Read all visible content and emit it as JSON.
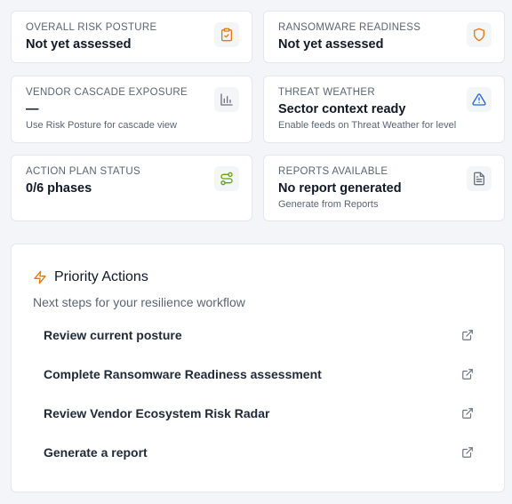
{
  "cards": [
    {
      "label": "OVERALL RISK POSTURE",
      "value": "Not yet assessed",
      "sub": "",
      "icon": "clipboard-check-icon",
      "icon_color": "#e8780c"
    },
    {
      "label": "RANSOMWARE READINESS",
      "value": "Not yet assessed",
      "sub": "",
      "icon": "shield-icon",
      "icon_color": "#e8780c"
    },
    {
      "label": "VENDOR CASCADE EXPOSURE",
      "value": "—",
      "sub": "Use Risk Posture for cascade view",
      "icon": "bar-chart-icon",
      "icon_color": "#6b7280"
    },
    {
      "label": "THREAT WEATHER",
      "value": "Sector context ready",
      "sub": "Enable feeds on Threat Weather for level",
      "icon": "alert-triangle-icon",
      "icon_color": "#2563eb"
    },
    {
      "label": "ACTION PLAN STATUS",
      "value": "0/6 phases",
      "sub": "",
      "icon": "route-icon",
      "icon_color": "#65a30d"
    },
    {
      "label": "REPORTS AVAILABLE",
      "value": "No report generated",
      "sub": "Generate from Reports",
      "icon": "file-text-icon",
      "icon_color": "#6b7280"
    }
  ],
  "priority": {
    "title": "Priority Actions",
    "subtitle": "Next steps for your resilience workflow",
    "title_icon": "zap-icon",
    "accent": "#e8780c",
    "actions": [
      {
        "label": "Review current posture"
      },
      {
        "label": "Complete Ransomware Readiness assessment"
      },
      {
        "label": "Review Vendor Ecosystem Risk Radar"
      },
      {
        "label": "Generate a report"
      }
    ]
  }
}
